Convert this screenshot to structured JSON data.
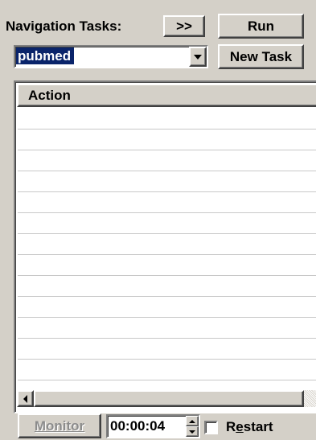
{
  "toolbar": {
    "nav_label": "Navigation Tasks:",
    "expand_label": ">>",
    "run_label": "Run",
    "new_task_label": "New Task"
  },
  "task_select": {
    "value": "pubmed"
  },
  "grid": {
    "columns": [
      "Action"
    ],
    "rows": []
  },
  "footer": {
    "monitor_label": "Monitor",
    "timer_value": "00:00:04",
    "restart_label_pre": "R",
    "restart_label_underlined": "e",
    "restart_label_post": "start",
    "restart_checked": false
  },
  "colors": {
    "window_bg": "#d4d0c8",
    "selection_bg": "#0a246a",
    "selection_fg": "#ffffff",
    "grid_bg": "#ffffff"
  }
}
